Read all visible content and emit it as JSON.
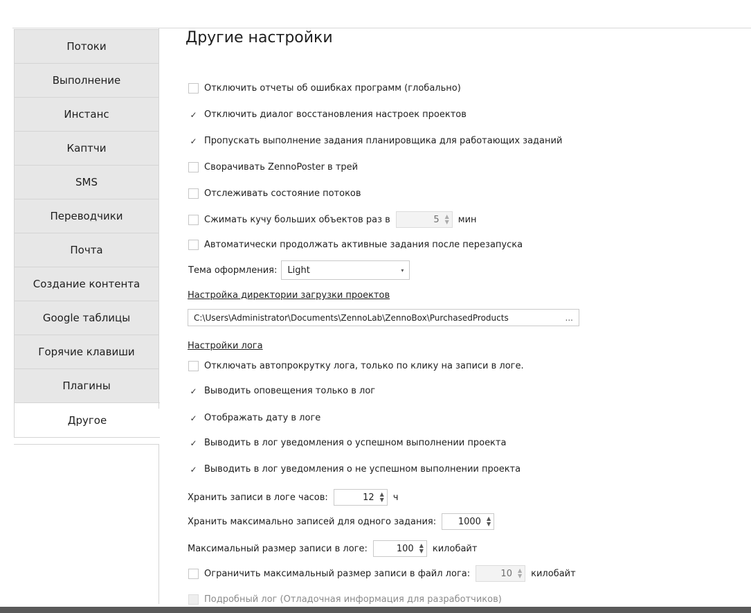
{
  "sidebar": {
    "items": [
      {
        "label": "Потоки"
      },
      {
        "label": "Выполнение"
      },
      {
        "label": "Инстанс"
      },
      {
        "label": "Каптчи"
      },
      {
        "label": "SMS"
      },
      {
        "label": "Переводчики"
      },
      {
        "label": "Почта"
      },
      {
        "label": "Создание контента"
      },
      {
        "label": "Google таблицы"
      },
      {
        "label": "Горячие клавиши"
      },
      {
        "label": "Плагины"
      },
      {
        "label": "Другое"
      }
    ],
    "active_index": 11
  },
  "main": {
    "title": "Другие настройки",
    "options": {
      "disable_error_reports": {
        "label": "Отключить отчеты об ошибках программ (глобально)",
        "checked": false
      },
      "disable_restore_dialog": {
        "label": "Отключить диалог восстановления настроек проектов",
        "checked": true
      },
      "skip_scheduler": {
        "label": "Пропускать выполнение задания планировщика для работающих заданий",
        "checked": true
      },
      "minimize_tray": {
        "label": "Сворачивать ZennoPoster в трей",
        "checked": false
      },
      "track_threads": {
        "label": "Отслеживать состояние потоков",
        "checked": false
      },
      "compress_heap": {
        "label": "Сжимать кучу больших объектов раз в",
        "checked": false,
        "value": "5",
        "unit": "мин"
      },
      "auto_resume": {
        "label": "Автоматически продолжать активные задания после перезапуска",
        "checked": false
      }
    },
    "theme": {
      "label": "Тема оформления:",
      "value": "Light"
    },
    "projects_dir": {
      "label": "Настройка директории загрузки проектов",
      "value": "C:\\Users\\Administrator\\Documents\\ZennoLab\\ZennoBox\\PurchasedProducts",
      "button": "..."
    },
    "log": {
      "section_label": "Настройки лога",
      "disable_autoscroll": {
        "label": "Отключать автопрокрутку лога, только по клику на записи в логе.",
        "checked": false
      },
      "notifications_only_log": {
        "label": "Выводить оповещения только в лог",
        "checked": true
      },
      "show_date": {
        "label": "Отображать дату в логе",
        "checked": true
      },
      "log_success": {
        "label": "Выводить в лог уведомления о успешном выполнении проекта",
        "checked": true
      },
      "log_failure": {
        "label": "Выводить в лог уведомления о не успешном выполнении проекта",
        "checked": true
      },
      "keep_hours": {
        "label": "Хранить записи в логе часов:",
        "value": "12",
        "unit": "ч"
      },
      "max_records": {
        "label": "Хранить максимально записей для одного задания:",
        "value": "1000"
      },
      "max_record_size": {
        "label": "Максимальный размер записи в логе:",
        "value": "100",
        "unit": "килобайт"
      },
      "limit_file_record": {
        "label": "Ограничить максимальный размер записи в файл лога:",
        "checked": false,
        "value": "10",
        "unit": "килобайт"
      },
      "verbose": {
        "label": "Подробный лог (Отладочная информация для разработчиков)",
        "checked": false
      }
    }
  },
  "icons": {
    "check": "✓",
    "spin_up": "▲",
    "spin_down": "▼",
    "caret": "▾"
  }
}
